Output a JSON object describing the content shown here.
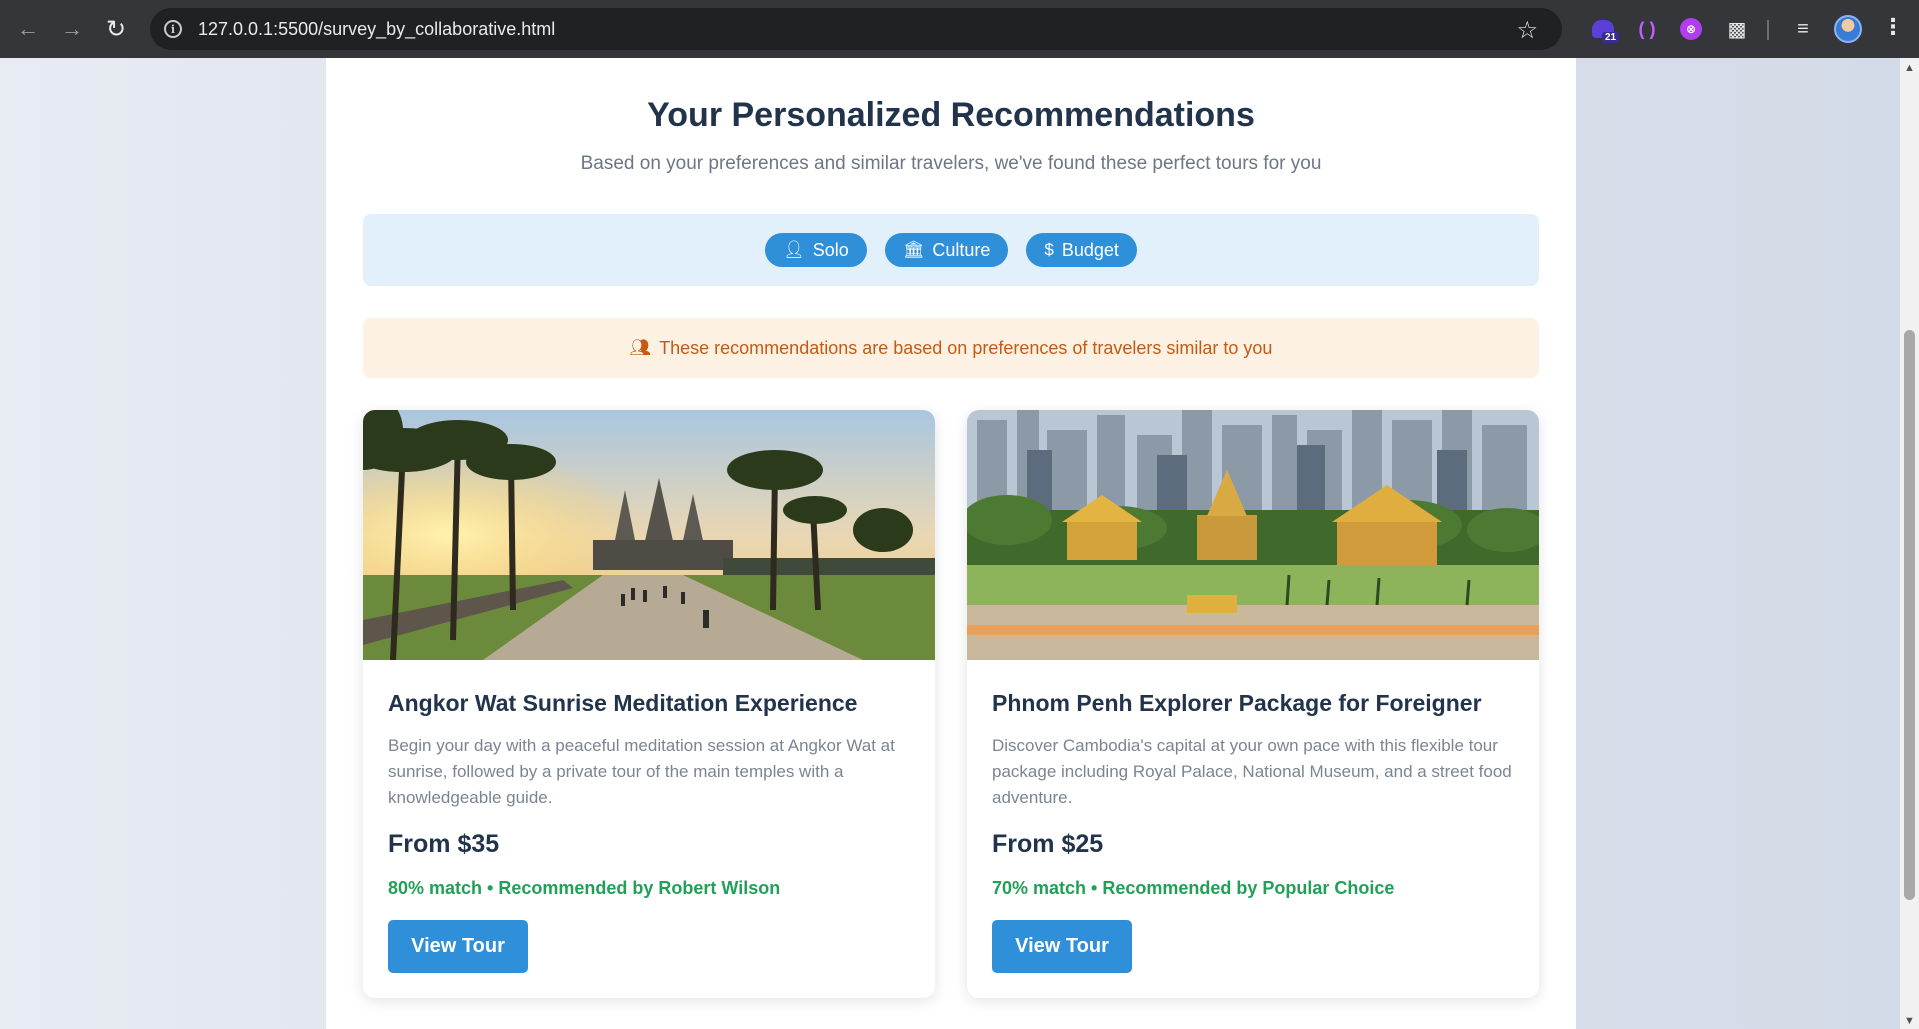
{
  "browser": {
    "url": "127.0.0.1:5500/survey_by_collaborative.html",
    "extension_badge": "21"
  },
  "page": {
    "title": "Your Personalized Recommendations",
    "subtitle": "Based on your preferences and similar travelers, we've found these perfect tours for you"
  },
  "preferences": [
    {
      "icon": "user-icon",
      "label": "Solo"
    },
    {
      "icon": "landmark-icon",
      "label": "Culture"
    },
    {
      "icon": "dollar-icon",
      "label": "Budget"
    }
  ],
  "notice": {
    "icon": "users-icon",
    "text": "These recommendations are based on preferences of travelers similar to you"
  },
  "tours": [
    {
      "title": "Angkor Wat Sunrise Meditation Experience",
      "description": "Begin your day with a peaceful meditation session at Angkor Wat at sunrise, followed by a private tour of the main temples with a knowledgeable guide.",
      "price": "From $35",
      "match": "80% match • Recommended by Robert Wilson",
      "button": "View Tour"
    },
    {
      "title": "Phnom Penh Explorer Package for Foreigner",
      "description": "Discover Cambodia's capital at your own pace with this flexible tour package including Royal Palace, National Museum, and a street food adventure.",
      "price": "From $25",
      "match": "70% match • Recommended by Popular Choice",
      "button": "View Tour"
    }
  ],
  "colors": {
    "accent": "#2f8fd8",
    "heading": "#22344c",
    "match_green": "#22a057",
    "notice_text": "#c65a12",
    "notice_bg": "#fdf1e3",
    "prefs_bg": "#e1f0fb"
  }
}
